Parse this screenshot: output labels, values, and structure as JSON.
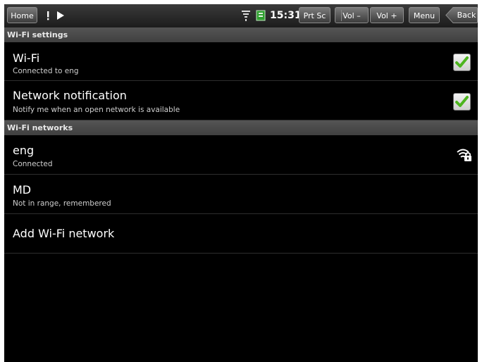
{
  "status_bar": {
    "home_label": "Home",
    "clock": "15:31",
    "prtsc_label": "Prt Sc",
    "vol_down_label": "Vol –",
    "vol_up_label": "Vol +",
    "menu_label": "Menu",
    "back_label": "Back",
    "icons": [
      "warning-icon",
      "play-icon",
      "wifi-status-icon",
      "battery-icon"
    ]
  },
  "sections": {
    "wifi_settings": "Wi-Fi settings",
    "wifi_networks": "Wi-Fi networks"
  },
  "settings": {
    "wifi": {
      "title": "Wi-Fi",
      "subtitle": "Connected to eng",
      "checked": true
    },
    "network_notification": {
      "title": "Network notification",
      "subtitle": "Notify me when an open network is available",
      "checked": true
    }
  },
  "networks": [
    {
      "ssid": "eng",
      "status": "Connected",
      "icon": "wifi-lock-icon"
    },
    {
      "ssid": "MD",
      "status": "Not in range, remembered"
    }
  ],
  "add_network_label": "Add Wi-Fi network",
  "colors": {
    "check": "#4db51f",
    "background": "#000000",
    "header": "#4a4a4a"
  }
}
